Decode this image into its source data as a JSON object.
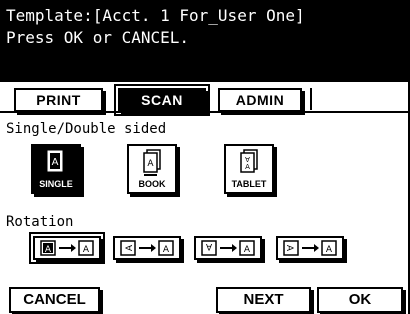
{
  "header": {
    "line1": "Template:[Acct. 1 For_User One]",
    "line2": "Press OK or CANCEL."
  },
  "tabs": [
    {
      "label": "PRINT",
      "active": false
    },
    {
      "label": "SCAN",
      "active": true
    },
    {
      "label": "ADMIN",
      "active": false
    }
  ],
  "duplex": {
    "label": "Single/Double sided",
    "options": [
      {
        "label": "SINGLE",
        "icon": "single-page-icon",
        "selected": true
      },
      {
        "label": "BOOK",
        "icon": "book-pages-icon",
        "selected": false
      },
      {
        "label": "TABLET",
        "icon": "tablet-pages-icon",
        "selected": false
      }
    ]
  },
  "rotation": {
    "label": "Rotation",
    "options": [
      {
        "icon": "rotate-none-icon",
        "selected": true
      },
      {
        "icon": "rotate-left-icon",
        "selected": false
      },
      {
        "icon": "rotate-180-icon",
        "selected": false
      },
      {
        "icon": "rotate-right-icon",
        "selected": false
      }
    ]
  },
  "buttons": {
    "cancel": "CANCEL",
    "next": "NEXT",
    "ok": "OK"
  }
}
